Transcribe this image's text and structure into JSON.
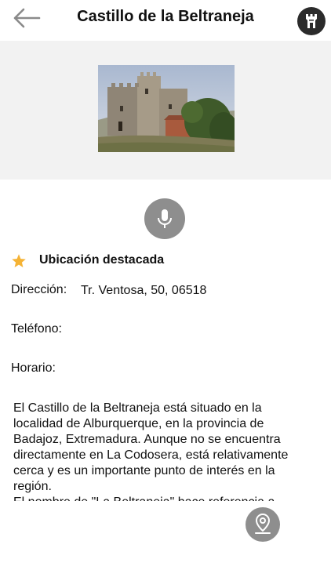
{
  "header": {
    "title": "Castillo de la Beltraneja",
    "back_icon": "arrow-left-icon",
    "castle_icon": "castle-tower-icon"
  },
  "hero": {
    "image": "castle-photo"
  },
  "audio": {
    "icon": "microphone-icon"
  },
  "featured": {
    "icon": "star-icon",
    "label": "Ubicación destacada",
    "color": "#f5b335"
  },
  "details": {
    "address_label": "Dirección:",
    "address_value": "Tr. Ventosa, 50, 06518",
    "phone_label": "Teléfono:",
    "hours_label": "Horario:"
  },
  "description": {
    "text": "El Castillo de la Beltraneja está situado en la localidad de Alburquerque, en la provincia de Badajoz, Extremadura. Aunque no se encuentra directamente en La Codosera, está relativamente cerca y es un importante punto de interés en la región.\nEl nombre de \"La Beltraneja\" hace referencia a"
  },
  "map_button": {
    "icon": "map-pin-icon"
  }
}
